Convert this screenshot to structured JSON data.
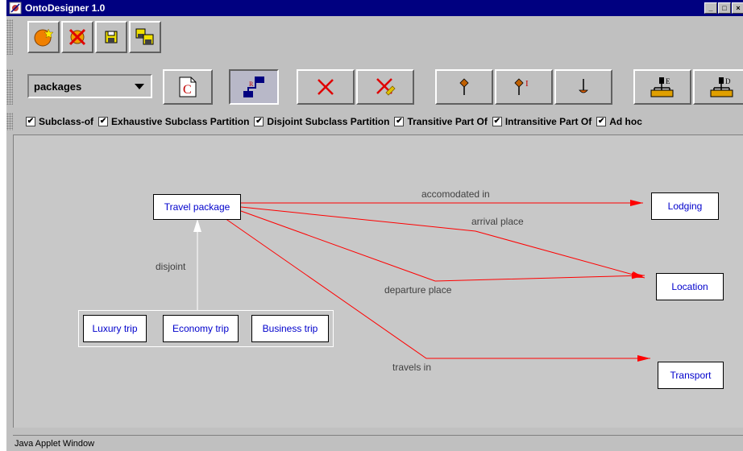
{
  "window": {
    "title": "OntoDesigner 1.0"
  },
  "window_buttons": [
    "_",
    "□",
    "×"
  ],
  "toolbar1": [
    {
      "icon": "new-ontology-icon"
    },
    {
      "icon": "delete-ontology-icon"
    },
    {
      "icon": "save-icon"
    },
    {
      "icon": "save-as-icon"
    }
  ],
  "package_select": {
    "value": "packages"
  },
  "toolbar2": [
    {
      "icon": "new-class-icon",
      "glyph": "C"
    },
    {
      "icon": "new-relation-icon",
      "glyph": "R"
    },
    {
      "icon": "delete-icon"
    },
    {
      "icon": "delete-link-icon"
    },
    {
      "icon": "pin-icon"
    },
    {
      "icon": "pin-instance-icon",
      "glyph": "I"
    },
    {
      "icon": "anchor-icon"
    },
    {
      "icon": "hierarchy-e-icon",
      "glyph": "E"
    },
    {
      "icon": "hierarchy-d-icon",
      "glyph": "D"
    }
  ],
  "relation_filters": [
    {
      "label": "Subclass-of",
      "checked": true
    },
    {
      "label": "Exhaustive Subclass Partition",
      "checked": true
    },
    {
      "label": "Disjoint Subclass Partition",
      "checked": true
    },
    {
      "label": "Transitive Part Of",
      "checked": true
    },
    {
      "label": "Intransitive Part Of",
      "checked": true
    },
    {
      "label": "Ad hoc",
      "checked": true
    }
  ],
  "diagram": {
    "nodes": {
      "travel_package": "Travel package",
      "lodging": "Lodging",
      "location": "Location",
      "transport": "Transport",
      "luxury_trip": "Luxury trip",
      "economy_trip": "Economy trip",
      "business_trip": "Business trip"
    },
    "edge_labels": {
      "accomodated_in": "accomodated in",
      "arrival_place": "arrival place",
      "departure_place": "departure place",
      "travels_in": "travels in",
      "disjoint": "disjoint"
    },
    "colors": {
      "relation": "#ff0000",
      "subclass": "#ffffff",
      "node_text": "#0000cc"
    }
  },
  "status": {
    "text": "Java Applet Window"
  }
}
